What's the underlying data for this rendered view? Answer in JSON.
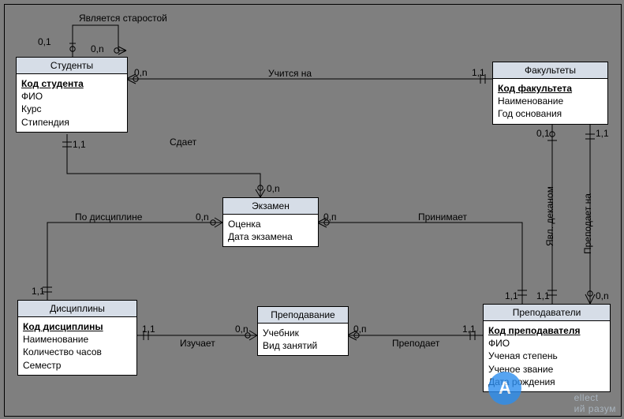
{
  "entities": {
    "students": {
      "title": "Студенты",
      "pk": "Код студента",
      "attrs": [
        "ФИО",
        "Курс",
        "Стипендия"
      ]
    },
    "faculties": {
      "title": "Факультеты",
      "pk": "Код факультета",
      "attrs": [
        "Наименование",
        "Год основания"
      ]
    },
    "exam": {
      "title": "Экзамен",
      "pk": null,
      "attrs": [
        "Оценка",
        "Дата экзамена"
      ]
    },
    "disciplines": {
      "title": "Дисциплины",
      "pk": "Код дисциплины",
      "attrs": [
        "Наименование",
        "Количество часов",
        "Семестр"
      ]
    },
    "teaching": {
      "title": "Преподавание",
      "pk": null,
      "attrs": [
        "Учебник",
        "Вид занятий"
      ]
    },
    "teachers": {
      "title": "Преподаватели",
      "pk": "Код преподавателя",
      "attrs": [
        "ФИО",
        "Ученая степень",
        "Ученое звание",
        "Дата рождения"
      ]
    }
  },
  "relationships": {
    "is_headman": {
      "label": "Является старостой",
      "card_from": "0,1",
      "card_to": "0,n"
    },
    "studies_at": {
      "label": "Учится на",
      "card_from": "0,n",
      "card_to": "1,1"
    },
    "takes_exam": {
      "label": "Сдает",
      "card_from": "1,1",
      "card_to": "0,n"
    },
    "by_discipline": {
      "label": "По дисциплине",
      "card_from": "0,n",
      "card_to": "1,1"
    },
    "receives_exam": {
      "label": "Принимает",
      "card_from": "0,п",
      "card_to": "1,1"
    },
    "is_dean": {
      "label": "Явл. деканом",
      "card_from": "0,1",
      "card_to": "1,1"
    },
    "teaches_at_fac": {
      "label": "Преподает на",
      "card_from": "1,1",
      "card_to": "0,n"
    },
    "learns": {
      "label": "Изучает",
      "card_from": "1,1",
      "card_to": "0,n"
    },
    "teaches": {
      "label": "Преподает",
      "card_from": "0,п",
      "card_to": "1,1"
    }
  },
  "watermark": {
    "logo_letter": "A",
    "text_part1": "ellect",
    "text_part2": "ий  разум"
  }
}
